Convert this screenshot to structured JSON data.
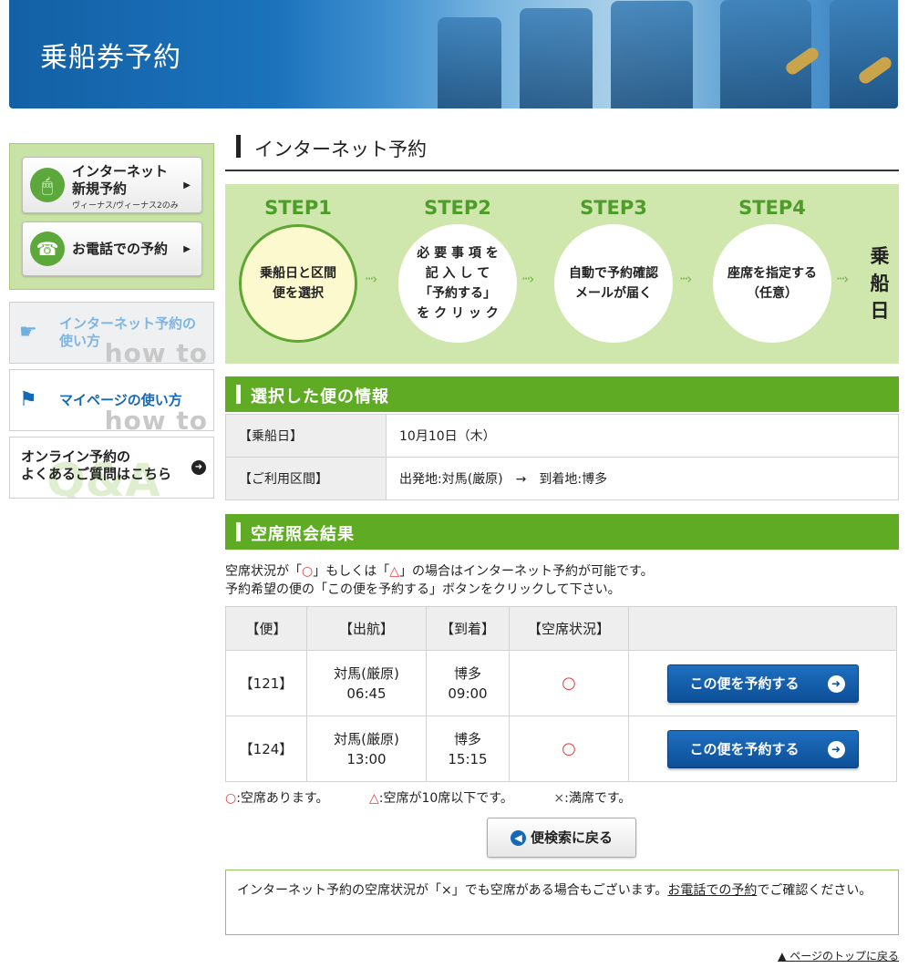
{
  "banner": {
    "title": "乗船券予約"
  },
  "sidebar": {
    "internet_new": {
      "line1": "インターネット",
      "line2": "新規予約",
      "sub": "ヴィーナス/ヴィーナス2のみ"
    },
    "phone": {
      "label": "お電話での予約"
    },
    "howto_internet": {
      "line1": "インターネット予約の",
      "line2": "使い方",
      "bg": "how to"
    },
    "howto_mypage": {
      "label": "マイページの使い方",
      "bg": "how to"
    },
    "faq": {
      "line1": "オンライン予約の",
      "line2": "よくあるご質問はこちら",
      "bg": "Q&A"
    }
  },
  "main": {
    "title": "インターネット予約",
    "steps": [
      {
        "label": "STEP1",
        "text": [
          "乗船日と区間",
          "便を選択"
        ]
      },
      {
        "label": "STEP2",
        "text": [
          "必 要 事 項 を",
          "記 入 し て",
          "「予約する」",
          "を ク リ ッ ク"
        ]
      },
      {
        "label": "STEP3",
        "text": [
          "自動で予約確認",
          "メールが届く"
        ]
      },
      {
        "label": "STEP4",
        "text": [
          "座席を指定する",
          "（任意）"
        ]
      }
    ],
    "final_step": [
      "乗",
      "船",
      "日"
    ],
    "selected_section": {
      "title": "選択した便の情報",
      "rows": [
        {
          "label": "【乗船日】",
          "value": "10月10日（木）"
        },
        {
          "label": "【ご利用区間】",
          "value": "出発地:対馬(厳原)　→　到着地:博多"
        }
      ]
    },
    "result_section": {
      "title": "空席照会結果",
      "text_pre": "空席状況が「",
      "mark_circle": "○",
      "text_mid": "」もしくは「",
      "mark_triangle": "△",
      "text_post": "」の場合はインターネット予約が可能です。",
      "text_line2": "予約希望の便の「この便を予約する」ボタンをクリックして下さい。",
      "headers": [
        "【便】",
        "【出航】",
        "【到着】",
        "【空席状況】",
        ""
      ],
      "rows": [
        {
          "flight": "【121】",
          "dep_place": "対馬(厳原)",
          "dep_time": "06:45",
          "arr_place": "博多",
          "arr_time": "09:00",
          "status": "○",
          "button": "この便を予約する"
        },
        {
          "flight": "【124】",
          "dep_place": "対馬(厳原)",
          "dep_time": "13:00",
          "arr_place": "博多",
          "arr_time": "15:15",
          "status": "○",
          "button": "この便を予約する"
        }
      ]
    },
    "legend": {
      "circle_mark": "○",
      "circle_text": ":空席あります。",
      "triangle_mark": "△",
      "triangle_text": ":空席が10席以下です。",
      "cross_mark": "×",
      "cross_text": ":満席です。"
    },
    "back_button": "便検索に戻る",
    "notice": {
      "pre": "インターネット予約の空席状況が「×」でも空席がある場合もございます。",
      "link": "お電話での予約",
      "post": "でご確認ください。"
    },
    "page_top_link": "▲ ページのトップに戻る"
  },
  "colors": {
    "green": "#5fac24",
    "blue": "#1468b8",
    "red": "#e04040"
  }
}
